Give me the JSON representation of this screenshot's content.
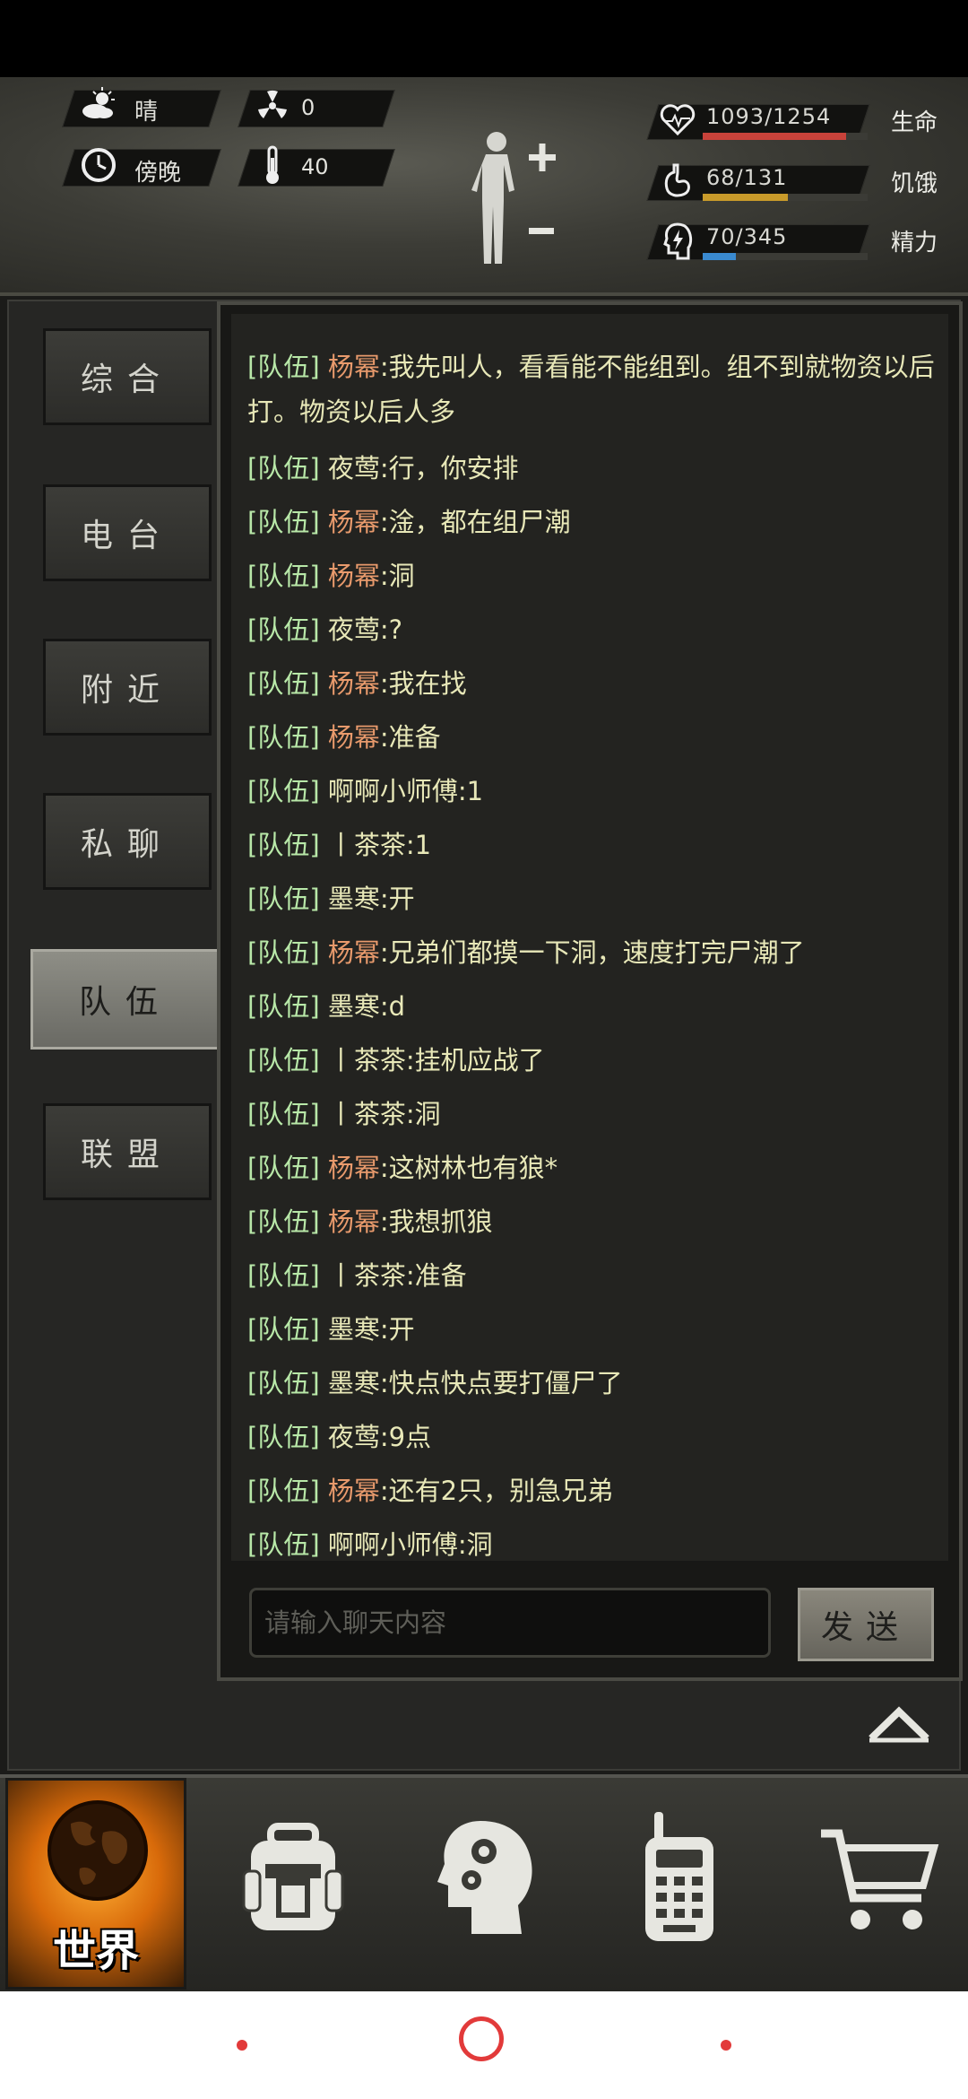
{
  "hud": {
    "weather": "晴",
    "radiation": "0",
    "time_of_day": "傍晚",
    "temperature": "40",
    "stats": [
      {
        "name": "health",
        "value": "1093/1254",
        "label": "生命",
        "fraction": 0.872,
        "color": "#c8423a",
        "icon": "heart-icon"
      },
      {
        "name": "hunger",
        "value": "68/131",
        "label": "饥饿",
        "fraction": 0.519,
        "color": "#c89a2a",
        "icon": "stomach-icon"
      },
      {
        "name": "energy",
        "value": "70/345",
        "label": "精力",
        "fraction": 0.203,
        "color": "#3a8ad0",
        "icon": "brain-bolt-icon"
      }
    ]
  },
  "tabs": [
    "综合",
    "电台",
    "附近",
    "私聊",
    "队伍",
    "联盟"
  ],
  "active_tab": "队伍",
  "chat": {
    "messages": [
      {
        "channel": "[队伍]",
        "name": "杨幂",
        "lead": true,
        "text": ":我先叫人，看看能不能组到。组不到就物资以后打。物资以后人多"
      },
      {
        "channel": "[队伍]",
        "name": "夜莺",
        "lead": false,
        "text": ":行，你安排"
      },
      {
        "channel": "[队伍]",
        "name": "杨幂",
        "lead": true,
        "text": ":淦，都在组尸潮"
      },
      {
        "channel": "[队伍]",
        "name": "杨幂",
        "lead": true,
        "text": ":洞"
      },
      {
        "channel": "[队伍]",
        "name": "夜莺",
        "lead": false,
        "text": ":?"
      },
      {
        "channel": "[队伍]",
        "name": "杨幂",
        "lead": true,
        "text": ":我在找"
      },
      {
        "channel": "[队伍]",
        "name": "杨幂",
        "lead": true,
        "text": ":准备"
      },
      {
        "channel": "[队伍]",
        "name": "啊啊小师傅",
        "lead": false,
        "text": ":1"
      },
      {
        "channel": "[队伍]",
        "name": "丨茶茶",
        "lead": false,
        "text": ":1"
      },
      {
        "channel": "[队伍]",
        "name": "墨寒",
        "lead": false,
        "text": ":开"
      },
      {
        "channel": "[队伍]",
        "name": "杨幂",
        "lead": true,
        "text": ":兄弟们都摸一下洞，速度打完尸潮了"
      },
      {
        "channel": "[队伍]",
        "name": "墨寒",
        "lead": false,
        "text": ":d"
      },
      {
        "channel": "[队伍]",
        "name": "丨茶茶",
        "lead": false,
        "text": ":挂机应战了"
      },
      {
        "channel": "[队伍]",
        "name": "丨茶茶",
        "lead": false,
        "text": ":洞"
      },
      {
        "channel": "[队伍]",
        "name": "杨幂",
        "lead": true,
        "text": ":这树林也有狼*"
      },
      {
        "channel": "[队伍]",
        "name": "杨幂",
        "lead": true,
        "text": ":我想抓狼"
      },
      {
        "channel": "[队伍]",
        "name": "丨茶茶",
        "lead": false,
        "text": ":准备"
      },
      {
        "channel": "[队伍]",
        "name": "墨寒",
        "lead": false,
        "text": ":开"
      },
      {
        "channel": "[队伍]",
        "name": "墨寒",
        "lead": false,
        "text": ":快点快点要打僵尸了"
      },
      {
        "channel": "[队伍]",
        "name": "夜莺",
        "lead": false,
        "text": ":9点"
      },
      {
        "channel": "[队伍]",
        "name": "杨幂",
        "lead": true,
        "text": ":还有2只，别急兄弟"
      },
      {
        "channel": "[队伍]",
        "name": "啊啊小师傅",
        "lead": false,
        "text": ":洞"
      }
    ],
    "input_placeholder": "请输入聊天内容",
    "send_label": "发送"
  },
  "bottom_nav": {
    "world_label": "世界",
    "items": [
      "backpack-icon",
      "head-gears-icon",
      "walkie-talkie-icon",
      "shopping-cart-icon"
    ]
  }
}
